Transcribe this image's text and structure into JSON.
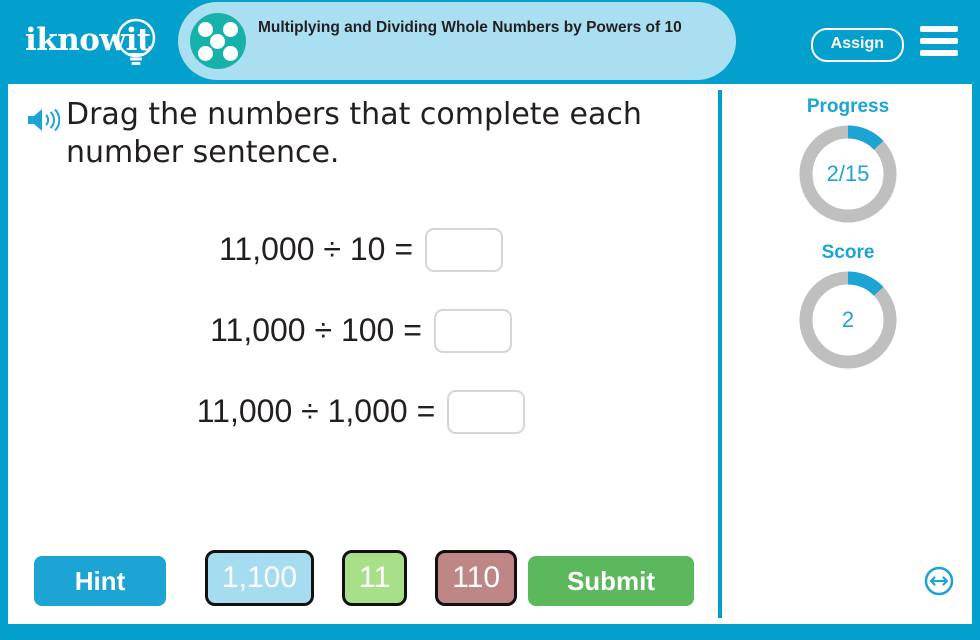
{
  "header": {
    "logo_text": "iknowit",
    "logo_icon": "lightbulb-icon",
    "dots_icon": "five-dots-icon",
    "title": "Multiplying and Dividing Whole Numbers by Powers of 10",
    "assign_label": "Assign",
    "menu_icon": "hamburger-menu-icon",
    "bar_color": "#03a0cd",
    "band_color": "#a9dff0",
    "dots_color": "#16b2aa"
  },
  "instruction": {
    "speaker_icon": "speaker-icon",
    "text": "Drag the numbers that complete each number sentence."
  },
  "equations": [
    {
      "text": "11,000 ÷ 10 =",
      "answer": ""
    },
    {
      "text": "11,000 ÷ 100 =",
      "answer": ""
    },
    {
      "text": "11,000 ÷ 1,000 =",
      "answer": ""
    }
  ],
  "tiles": [
    {
      "label": "1,100",
      "color": "#a5dcf0"
    },
    {
      "label": "11",
      "color": "#a8e08a"
    },
    {
      "label": "110",
      "color": "#bf8686"
    }
  ],
  "buttons": {
    "hint_label": "Hint",
    "hint_color": "#1ba4d4",
    "submit_label": "Submit",
    "submit_color": "#5cb85c"
  },
  "sidebar": {
    "progress": {
      "label": "Progress",
      "value": "2/15",
      "percent": 13,
      "arc_color": "#1ba4d4",
      "track_color": "#bfbfbf"
    },
    "score": {
      "label": "Score",
      "value": "2",
      "percent": 13,
      "arc_color": "#1ba4d4",
      "track_color": "#bfbfbf"
    },
    "resize_icon": "resize-horizontal-icon"
  }
}
